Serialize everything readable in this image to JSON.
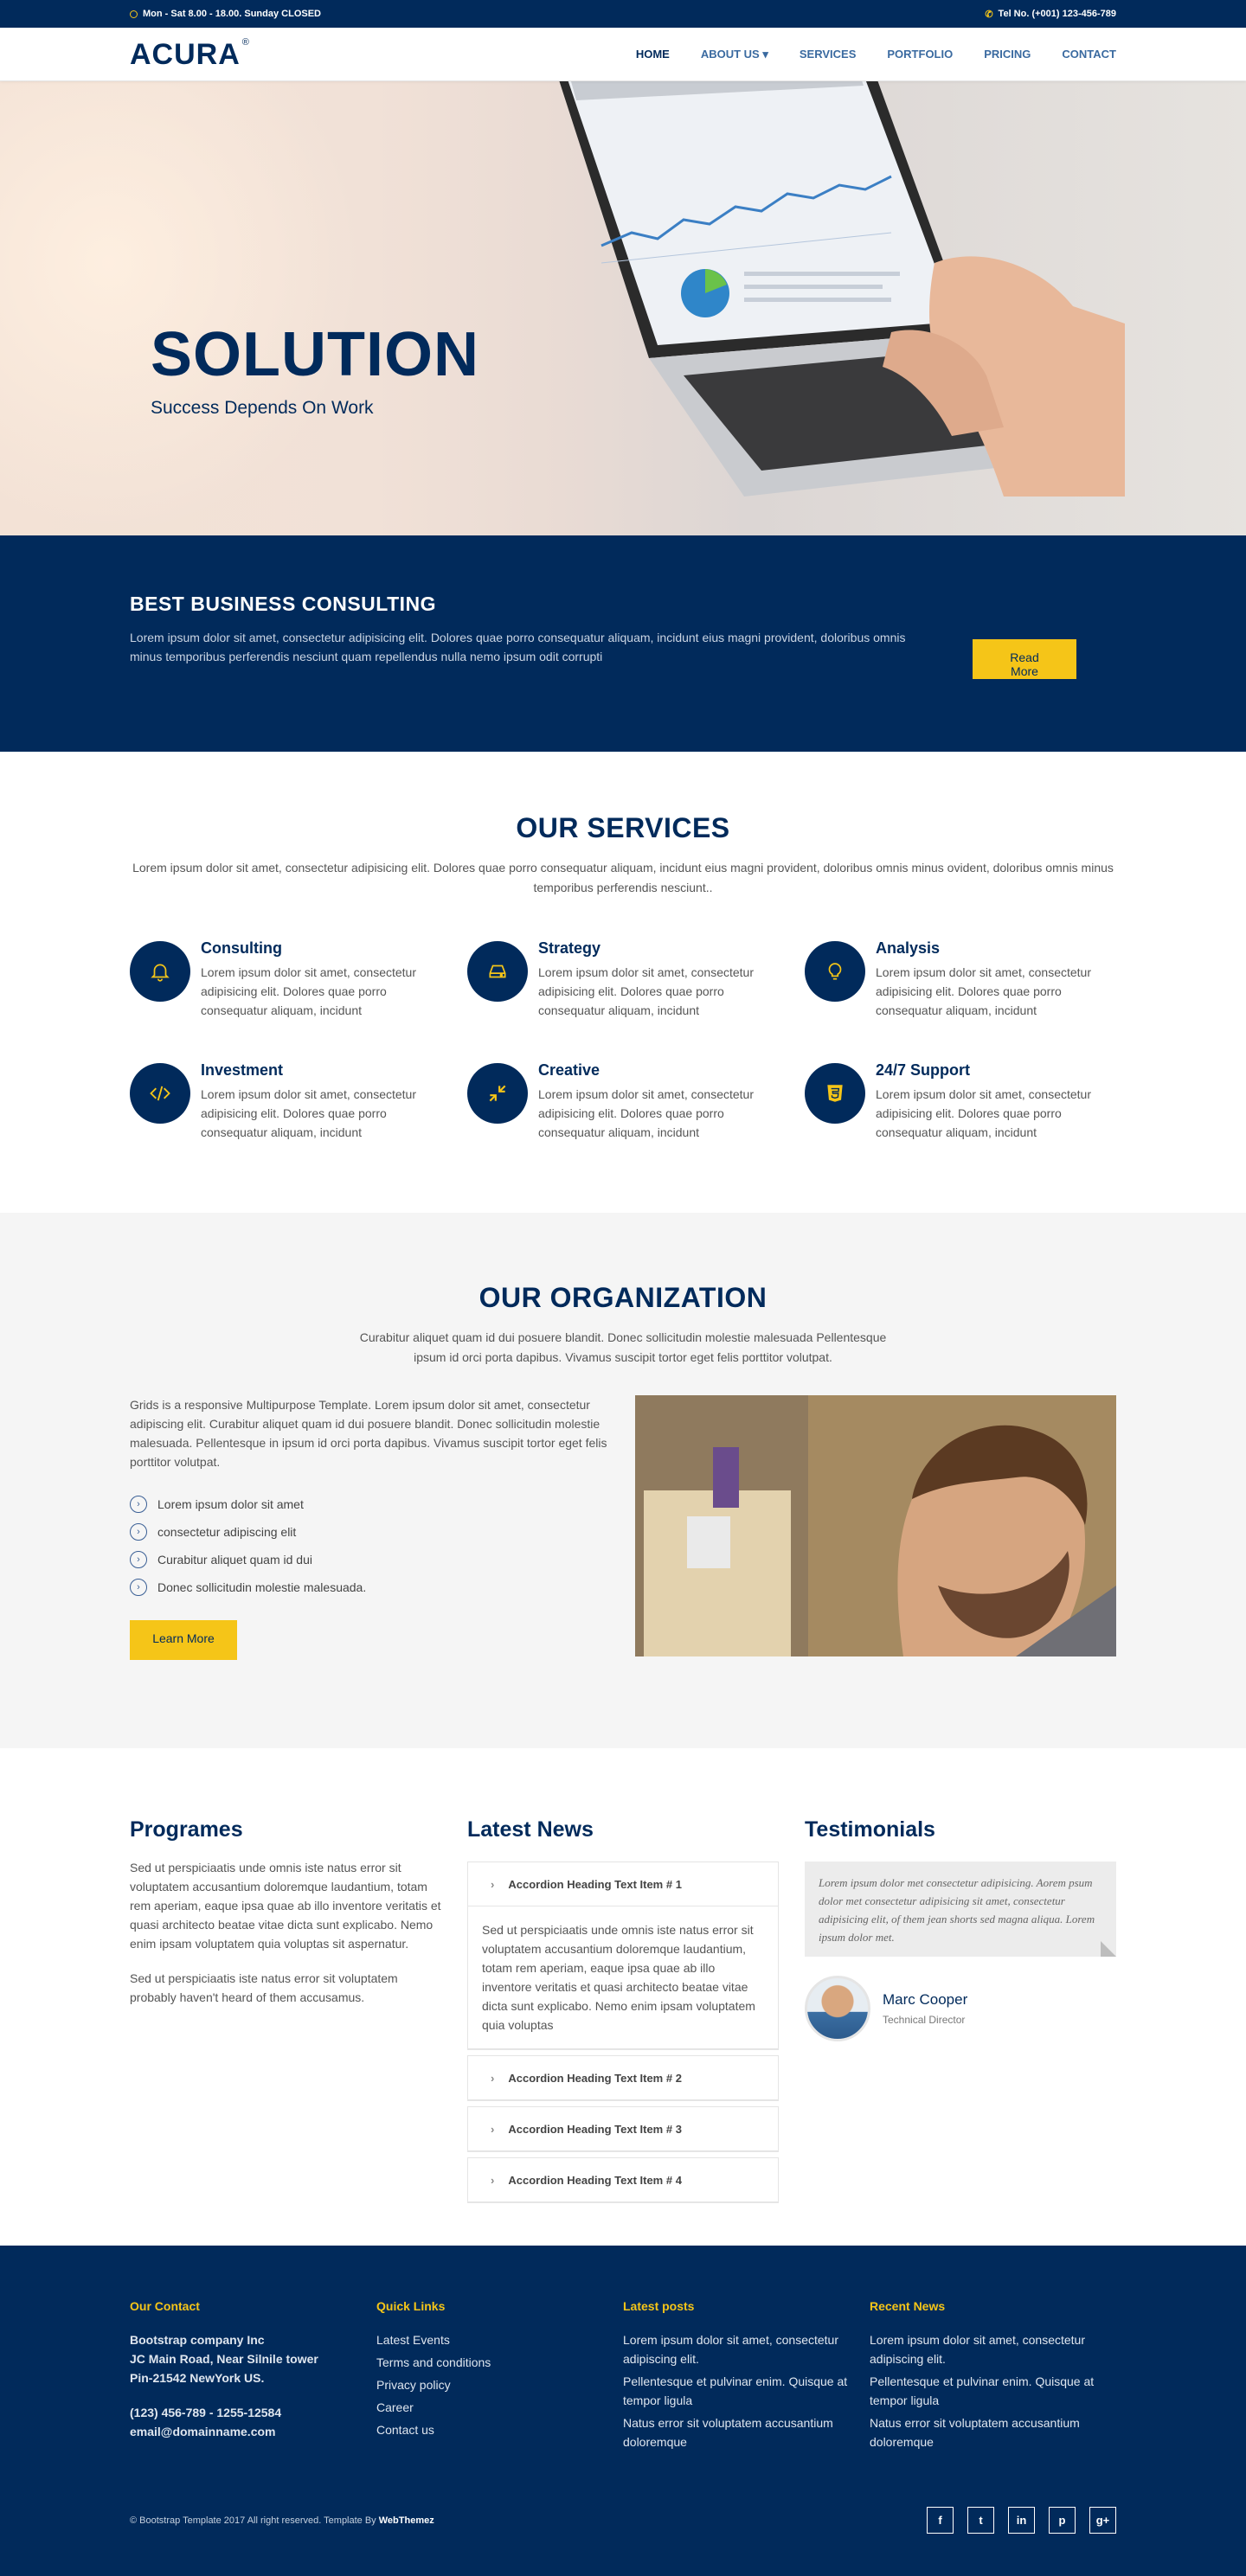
{
  "topbar": {
    "hours": "Mon - Sat 8.00 - 18.00. Sunday CLOSED",
    "phone": "Tel No. (+001) 123-456-789"
  },
  "nav": {
    "logo": "ACURA",
    "logo_mark": "®",
    "items": [
      {
        "label": "HOME",
        "active": true
      },
      {
        "label": "ABOUT US ▾"
      },
      {
        "label": "SERVICES"
      },
      {
        "label": "PORTFOLIO"
      },
      {
        "label": "PRICING"
      },
      {
        "label": "CONTACT"
      }
    ]
  },
  "hero": {
    "title": "SOLUTION",
    "subtitle": "Success Depends On Work"
  },
  "consulting": {
    "title": "BEST BUSINESS CONSULTING",
    "text": "Lorem ipsum dolor sit amet, consectetur adipisicing elit. Dolores quae porro consequatur aliquam, incidunt eius magni provident, doloribus omnis minus temporibus perferendis nesciunt quam repellendus nulla nemo ipsum odit corrupti",
    "button": "Read More"
  },
  "services": {
    "title": "OUR SERVICES",
    "intro": "Lorem ipsum dolor sit amet, consectetur adipisicing elit. Dolores quae porro consequatur aliquam, incidunt eius magni provident, doloribus omnis minus ovident, doloribus omnis minus temporibus perferendis nesciunt..",
    "items": [
      {
        "title": "Consulting",
        "text": "Lorem ipsum dolor sit amet, consectetur adipisicing elit. Dolores quae porro consequatur aliquam, incidunt",
        "icon": "bell-icon"
      },
      {
        "title": "Strategy",
        "text": "Lorem ipsum dolor sit amet, consectetur adipisicing elit. Dolores quae porro consequatur aliquam, incidunt",
        "icon": "hard-drive-icon"
      },
      {
        "title": "Analysis",
        "text": "Lorem ipsum dolor sit amet, consectetur adipisicing elit. Dolores quae porro consequatur aliquam, incidunt",
        "icon": "lightbulb-icon"
      },
      {
        "title": "Investment",
        "text": "Lorem ipsum dolor sit amet, consectetur adipisicing elit. Dolores quae porro consequatur aliquam, incidunt",
        "icon": "code-icon"
      },
      {
        "title": "Creative",
        "text": "Lorem ipsum dolor sit amet, consectetur adipisicing elit. Dolores quae porro consequatur aliquam, incidunt",
        "icon": "compress-icon"
      },
      {
        "title": "24/7 Support",
        "text": "Lorem ipsum dolor sit amet, consectetur adipisicing elit. Dolores quae porro consequatur aliquam, incidunt",
        "icon": "html5-icon"
      }
    ]
  },
  "organization": {
    "title": "OUR ORGANIZATION",
    "intro": "Curabitur aliquet quam id dui posuere blandit. Donec sollicitudin molestie malesuada Pellentesque ipsum id orci porta dapibus. Vivamus suscipit tortor eget felis porttitor volutpat.",
    "paragraph": "Grids is a responsive Multipurpose Template. Lorem ipsum dolor sit amet, consectetur adipiscing elit. Curabitur aliquet quam id dui posuere blandit. Donec sollicitudin molestie malesuada. Pellentesque in ipsum id orci porta dapibus. Vivamus suscipit tortor eget felis porttitor volutpat.",
    "list": [
      "Lorem ipsum dolor sit amet",
      "consectetur adipiscing elit",
      "Curabitur aliquet quam id dui",
      "Donec sollicitudin molestie malesuada."
    ],
    "button": "Learn More"
  },
  "programes": {
    "title": "Programes",
    "p1": "Sed ut perspiciaatis unde omnis iste natus error sit voluptatem accusantium doloremque laudantium, totam rem aperiam, eaque ipsa quae ab illo inventore veritatis et quasi architecto beatae vitae dicta sunt explicabo. Nemo enim ipsam voluptatem quia voluptas sit aspernatur.",
    "p2": "Sed ut perspiciaatis iste natus error sit voluptatem probably haven't heard of them accusamus."
  },
  "news": {
    "title": "Latest News",
    "items": [
      {
        "heading": "Accordion Heading Text Item # 1",
        "body": "Sed ut perspiciaatis unde omnis iste natus error sit voluptatem accusantium doloremque laudantium, totam rem aperiam, eaque ipsa quae ab illo inventore veritatis et quasi architecto beatae vitae dicta sunt explicabo. Nemo enim ipsam voluptatem quia voluptas"
      },
      {
        "heading": "Accordion Heading Text Item # 2"
      },
      {
        "heading": "Accordion Heading Text Item # 3"
      },
      {
        "heading": "Accordion Heading Text Item # 4"
      }
    ]
  },
  "testimonials": {
    "title": "Testimonials",
    "quote": "Lorem ipsum dolor met consectetur adipisicing. Aorem psum dolor met consectetur adipisicing sit amet, consectetur adipisicing elit, of them jean shorts sed magna aliqua. Lorem ipsum dolor met.",
    "name": "Marc Cooper",
    "role": "Technical Director"
  },
  "footer": {
    "contact": {
      "title": "Our Contact",
      "company": "Bootstrap company Inc",
      "addr1": "JC Main Road, Near Silnile tower",
      "addr2": "Pin-21542 NewYork US.",
      "phone": "(123) 456-789 - 1255-12584",
      "email": "email@domainname.com"
    },
    "quick": {
      "title": "Quick Links",
      "links": [
        "Latest Events",
        "Terms and conditions",
        "Privacy policy",
        "Career",
        "Contact us"
      ]
    },
    "posts": {
      "title": "Latest posts",
      "items": [
        "Lorem ipsum dolor sit amet, consectetur adipiscing elit.",
        "Pellentesque et pulvinar enim. Quisque at tempor ligula",
        "Natus error sit voluptatem accusantium doloremque"
      ]
    },
    "recent": {
      "title": "Recent News",
      "items": [
        "Lorem ipsum dolor sit amet, consectetur adipiscing elit.",
        "Pellentesque et pulvinar enim. Quisque at tempor ligula",
        "Natus error sit voluptatem accusantium doloremque"
      ]
    },
    "copyright": "© Bootstrap Template 2017 All right reserved. Template By ",
    "brand": "WebThemez",
    "social": [
      "f",
      "t",
      "in",
      "p",
      "g+"
    ]
  },
  "colors": {
    "navy": "#012a5b",
    "yellow": "#f5c518"
  }
}
